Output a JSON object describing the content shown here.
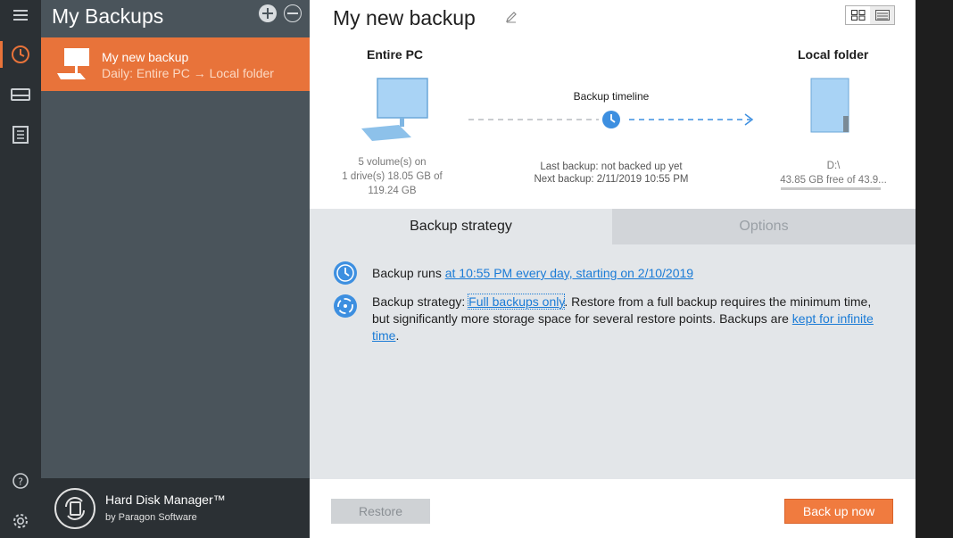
{
  "sidebar": {
    "title": "My Backups",
    "items": [
      {
        "name": "My new backup",
        "subtitle": "Daily: Entire PC → Local folder"
      }
    ],
    "footer": {
      "product": "Hard Disk Manager™",
      "vendor": "by Paragon Software"
    }
  },
  "rail": {
    "icons": [
      "menu-icon",
      "backup-clock-icon",
      "drive-icon",
      "log-icon",
      "help-icon",
      "settings-icon"
    ]
  },
  "main": {
    "title": "My new backup",
    "source": {
      "label": "Entire PC",
      "info_lines": [
        "5 volume(s) on",
        "1 drive(s) 18.05 GB of",
        "119.24 GB"
      ]
    },
    "destination": {
      "label": "Local folder",
      "path": "D:\\",
      "free": "43.85 GB free of 43.9..."
    },
    "timeline": {
      "label": "Backup timeline",
      "last_backup": "Last backup: not backed up yet",
      "next_backup": "Next backup: 2/11/2019 10:55 PM"
    },
    "tabs": [
      {
        "label": "Backup strategy",
        "active": true
      },
      {
        "label": "Options",
        "active": false
      }
    ],
    "schedule": {
      "prefix": "Backup runs ",
      "link": "at 10:55 PM every day, starting on 2/10/2019"
    },
    "strategy": {
      "prefix": "Backup strategy: ",
      "link1": "Full backups only",
      "middle": ". Restore from a full backup requires the minimum time, but significantly more storage space for several restore points. Backups are ",
      "link2": "kept for infinite time",
      "suffix": "."
    },
    "buttons": {
      "restore": "Restore",
      "backup_now": "Back up now"
    }
  },
  "colors": {
    "accent": "#e8733a",
    "link": "#1a7bd6",
    "sidebar_bg": "#4a545b",
    "rail_bg": "#2b3034",
    "icon_blue": "#3d8fe0"
  }
}
